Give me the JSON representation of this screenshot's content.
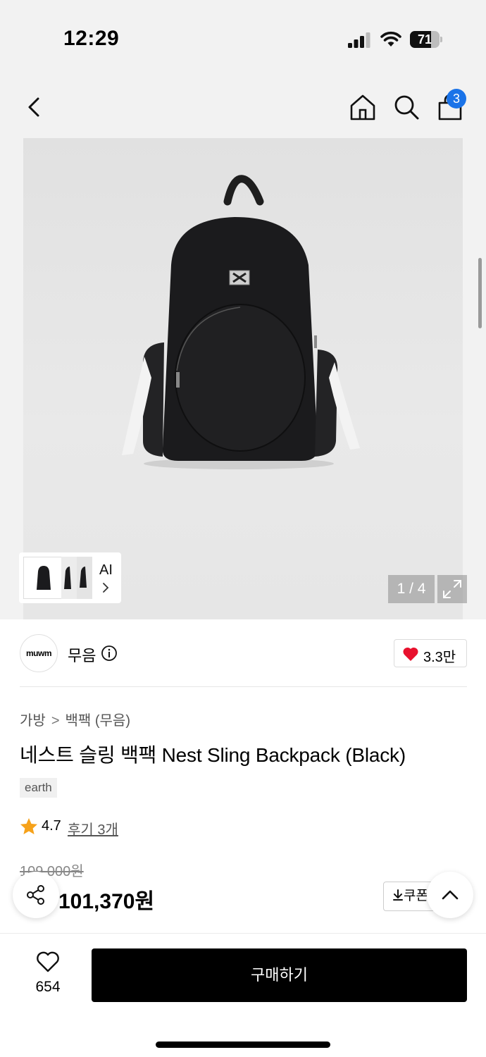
{
  "status_bar": {
    "time": "12:29",
    "battery_percent": "71",
    "battery_level": 0.71
  },
  "header": {
    "cart_count": "3"
  },
  "gallery": {
    "page_counter": "1 / 4",
    "ai_label": "AI"
  },
  "brand": {
    "logo_text": "muwm",
    "name": "무음",
    "like_count": "3.3만"
  },
  "breadcrumb": [
    "가방",
    "백팩 (무음)"
  ],
  "breadcrumb_separator": ">",
  "product": {
    "title": "네스트 슬링 백팩 Nest Sling Backpack (Black)",
    "tag": "earth",
    "rating": "4.7",
    "review_link": "후기 3개",
    "original_price": "109,000원",
    "sale_price": "101,370원",
    "coupon_label": "쿠폰 받기"
  },
  "bottom_bar": {
    "wish_count": "654",
    "buy_label": "구매하기"
  },
  "colors": {
    "accent_blue": "#1a73e8",
    "heart_red": "#e8112d",
    "star_orange": "#f6a21a",
    "buy_button": "#000000"
  }
}
